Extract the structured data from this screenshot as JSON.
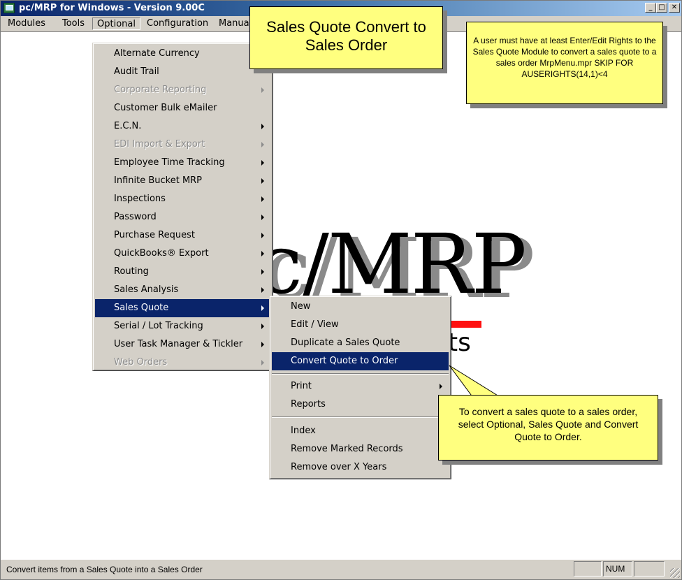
{
  "window": {
    "title": "pc/MRP for Windows - Version 9.00C",
    "controls": {
      "minimize": "_",
      "maximize": "□",
      "close": "✕"
    }
  },
  "menubar": {
    "items": [
      {
        "label": "Modules"
      },
      {
        "label": "Tools"
      },
      {
        "label": "Optional"
      },
      {
        "label": "Configuration"
      },
      {
        "label": "Manua"
      }
    ]
  },
  "optional_menu": {
    "items": [
      {
        "label": "Alternate Currency",
        "enabled": true,
        "submenu": false
      },
      {
        "label": "Audit Trail",
        "enabled": true,
        "submenu": false
      },
      {
        "label": "Corporate Reporting",
        "enabled": false,
        "submenu": true
      },
      {
        "label": "Customer Bulk eMailer",
        "enabled": true,
        "submenu": false
      },
      {
        "label": "E.C.N.",
        "enabled": true,
        "submenu": true
      },
      {
        "label": "EDI Import & Export",
        "enabled": false,
        "submenu": true
      },
      {
        "label": "Employee Time Tracking",
        "enabled": true,
        "submenu": true
      },
      {
        "label": "Infinite Bucket MRP",
        "enabled": true,
        "submenu": true
      },
      {
        "label": "Inspections",
        "enabled": true,
        "submenu": true
      },
      {
        "label": "Password",
        "enabled": true,
        "submenu": true
      },
      {
        "label": "Purchase Request",
        "enabled": true,
        "submenu": true
      },
      {
        "label": "QuickBooks® Export",
        "enabled": true,
        "submenu": true
      },
      {
        "label": "Routing",
        "enabled": true,
        "submenu": true
      },
      {
        "label": "Sales Analysis",
        "enabled": true,
        "submenu": true
      },
      {
        "label": "Sales Quote",
        "enabled": true,
        "submenu": true,
        "selected": true
      },
      {
        "label": "Serial / Lot Tracking",
        "enabled": true,
        "submenu": true
      },
      {
        "label": "User Task Manager & Tickler",
        "enabled": true,
        "submenu": true
      },
      {
        "label": "Web Orders",
        "enabled": false,
        "submenu": true
      }
    ]
  },
  "sales_quote_menu": {
    "items": [
      {
        "label": "New",
        "submenu": false
      },
      {
        "label": "Edit / View",
        "submenu": false
      },
      {
        "label": "Duplicate a Sales Quote",
        "submenu": false
      },
      {
        "label": "Convert Quote to Order",
        "submenu": false,
        "selected": true
      },
      {
        "label": "Print",
        "submenu": true
      },
      {
        "label": "Reports",
        "submenu": false
      },
      {
        "label": "Index",
        "submenu": false
      },
      {
        "label": "Remove Marked Records",
        "submenu": false
      },
      {
        "label": "Remove over X Years",
        "submenu": false
      }
    ]
  },
  "logo": {
    "main": "c/MRP",
    "sub": "ts"
  },
  "callouts": {
    "title": "Sales Quote Convert to Sales Order",
    "rights_note": "A user must have at least Enter/Edit Rights to the Sales Quote Module to convert a sales quote to a sales order MrpMenu.mpr SKIP FOR AUSERIGHTS(14,1)<4",
    "instruction": "To convert a sales quote to a sales order, select Optional, Sales Quote and Convert Quote to Order."
  },
  "statusbar": {
    "message": "Convert items from a Sales Quote into a Sales Order",
    "panels": [
      "",
      "NUM",
      ""
    ]
  },
  "colors": {
    "title_gradient_start": "#0a246a",
    "title_gradient_end": "#a6caf0",
    "menu_face": "#d4d0c8",
    "selection": "#0a246a",
    "callout_fill": "#ffff7f",
    "logo_accent": "#ff1010"
  }
}
